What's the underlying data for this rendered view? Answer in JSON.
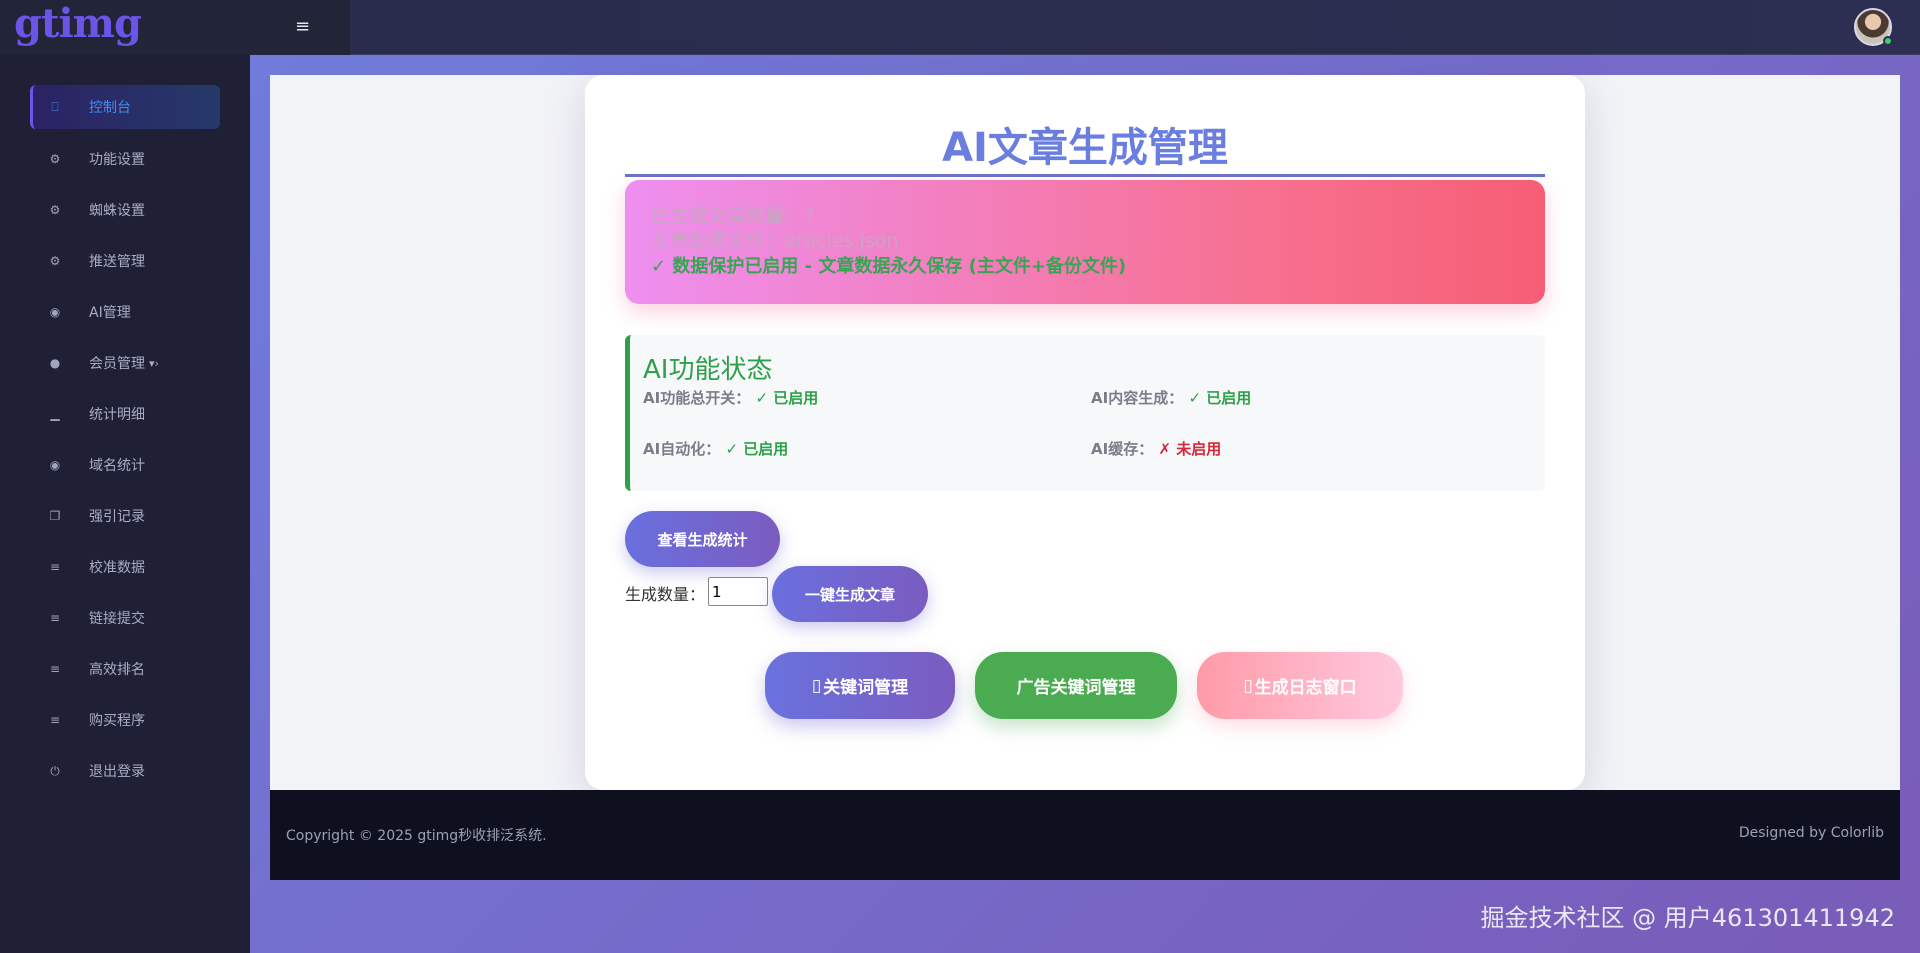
{
  "header": {
    "brand": "gtimg",
    "menu_icon": "hamburger-icon",
    "avatar": "user-avatar",
    "status_color": "#3ccf6b"
  },
  "sidebar": {
    "items": [
      {
        "label": "控制台",
        "icon": "laptop-icon",
        "active": true
      },
      {
        "label": "功能设置",
        "icon": "gears-icon"
      },
      {
        "label": "蜘蛛设置",
        "icon": "gears-icon"
      },
      {
        "label": "推送管理",
        "icon": "gears-icon"
      },
      {
        "label": "AI管理",
        "icon": "globe-icon"
      },
      {
        "label": "会员管理",
        "icon": "users-icon"
      },
      {
        "label": "统计明细",
        "icon": "bar-chart-icon"
      },
      {
        "label": "域名统计",
        "icon": "globe-icon"
      },
      {
        "label": "强引记录",
        "icon": "copy-icon"
      },
      {
        "label": "校准数据",
        "icon": "list-icon"
      },
      {
        "label": "链接提交",
        "icon": "list-icon"
      },
      {
        "label": "高效排名",
        "icon": "list-icon"
      },
      {
        "label": "购买程序",
        "icon": "list-icon"
      },
      {
        "label": "退出登录",
        "icon": "power-icon"
      }
    ]
  },
  "main": {
    "title": "AI文章生成管理",
    "info": {
      "count_line": "已生成文章数量：7",
      "file_line": "文章数据文件：articles.json",
      "protect_line": "✓ 数据保护已启用 - 文章数据永久保存 (主文件+备份文件)"
    },
    "status": {
      "title": "AI功能状态",
      "items": [
        {
          "label": "AI功能总开关：",
          "value": "✓ 已启用",
          "state": "ok"
        },
        {
          "label": "AI内容生成：",
          "value": "✓ 已启用",
          "state": "ok"
        },
        {
          "label": "AI自动化：",
          "value": "✓ 已启用",
          "state": "ok"
        },
        {
          "label": "AI缓存：",
          "value": "✗ 未启用",
          "state": "bad"
        }
      ]
    },
    "buttons": {
      "stats": "查看生成统计",
      "qty_label": "生成数量：",
      "qty_value": "1",
      "generate": "一键生成文章",
      "keywords": "关键词管理",
      "ad_keywords": "广告关键词管理",
      "log": "生成日志窗口"
    }
  },
  "footer": {
    "copyright": "Copyright © 2025 gtimg秒收排泛系统.",
    "designed": "Designed by Colorlib"
  },
  "watermark": "掘金技术社区 @ 用户461301411942"
}
